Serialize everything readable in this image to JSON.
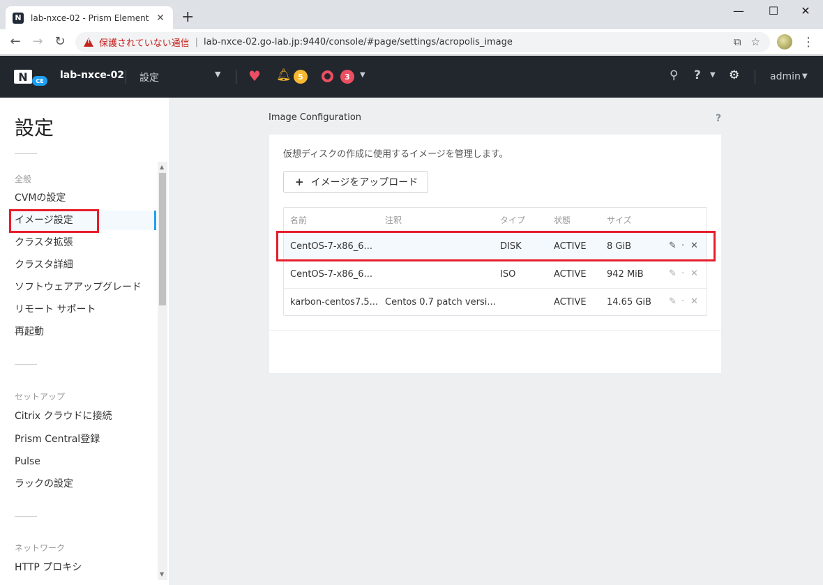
{
  "browser": {
    "tab_title": "lab-nxce-02 - Prism Element",
    "favicon": "N",
    "new_tab": "+",
    "security_label": "保護されていない通信",
    "url": "lab-nxce-02.go-lab.jp:9440/console/#page/settings/acropolis_image",
    "controls": {
      "minimize": "—",
      "maximize": "☐",
      "close": "✕"
    }
  },
  "header": {
    "logo_text": "N",
    "logo_badge": "CE",
    "cluster_name": "lab-nxce-02",
    "section": "設定",
    "alerts_warning_count": "5",
    "alerts_critical_count": "3",
    "user": "admin",
    "colors": {
      "bar": "#22272e",
      "warning": "#f5b82e",
      "critical": "#ec4e62"
    }
  },
  "leftnav": {
    "title": "設定",
    "groups": [
      {
        "label": "全般",
        "items": [
          "CVMの設定",
          "イメージ設定",
          "クラスタ拡張",
          "クラスタ詳細",
          "ソフトウェアアップグレード",
          "リモート サポート",
          "再起動"
        ]
      },
      {
        "label": "セットアップ",
        "items": [
          "Citrix クラウドに接続",
          "Prism Central登録",
          "Pulse",
          "ラックの設定"
        ]
      },
      {
        "label": "ネットワーク",
        "items": [
          "HTTP プロキシ"
        ]
      }
    ],
    "active_item": "イメージ設定"
  },
  "main": {
    "panel_title": "Image Configuration",
    "help": "?",
    "description": "仮想ディスクの作成に使用するイメージを管理します。",
    "upload_plus": "+",
    "upload_label": "イメージをアップロード",
    "columns": [
      "名前",
      "注釈",
      "タイプ",
      "状態",
      "サイズ"
    ],
    "rows": [
      {
        "name": "CentOS-7-x86_6...",
        "annotation": "",
        "type": "DISK",
        "state": "ACTIVE",
        "size": "8 GiB"
      },
      {
        "name": "CentOS-7-x86_6...",
        "annotation": "",
        "type": "ISO",
        "state": "ACTIVE",
        "size": "942 MiB"
      },
      {
        "name": "karbon-centos7.5...",
        "annotation": "Centos 0.7 patch versi...",
        "type": "",
        "state": "ACTIVE",
        "size": "14.65 GiB"
      }
    ],
    "row_actions": {
      "edit": "✎",
      "sep": "·",
      "delete": "✕"
    }
  },
  "accent_color": "#1e9ff2",
  "highlight_color": "#e61d2a"
}
